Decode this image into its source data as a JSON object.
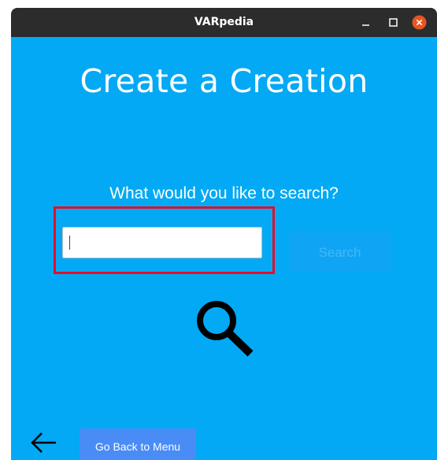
{
  "window": {
    "title": "VARpedia",
    "controls": {
      "minimize_icon": "minimize-icon",
      "maximize_icon": "maximize-icon",
      "close_icon": "close-icon"
    }
  },
  "page": {
    "heading": "Create a Creation",
    "prompt": "What would you like to search?"
  },
  "search": {
    "value": "",
    "placeholder": "",
    "button_label": "Search",
    "icon": "magnifier-icon"
  },
  "footer": {
    "back_icon": "arrow-left-icon",
    "menu_button_label": "Go Back to Menu"
  },
  "colors": {
    "background": "#03a9f4",
    "titlebar": "#2c2c2c",
    "highlight_border": "#e0102a",
    "close_button": "#e95420",
    "menu_button": "#4a8cf6"
  }
}
